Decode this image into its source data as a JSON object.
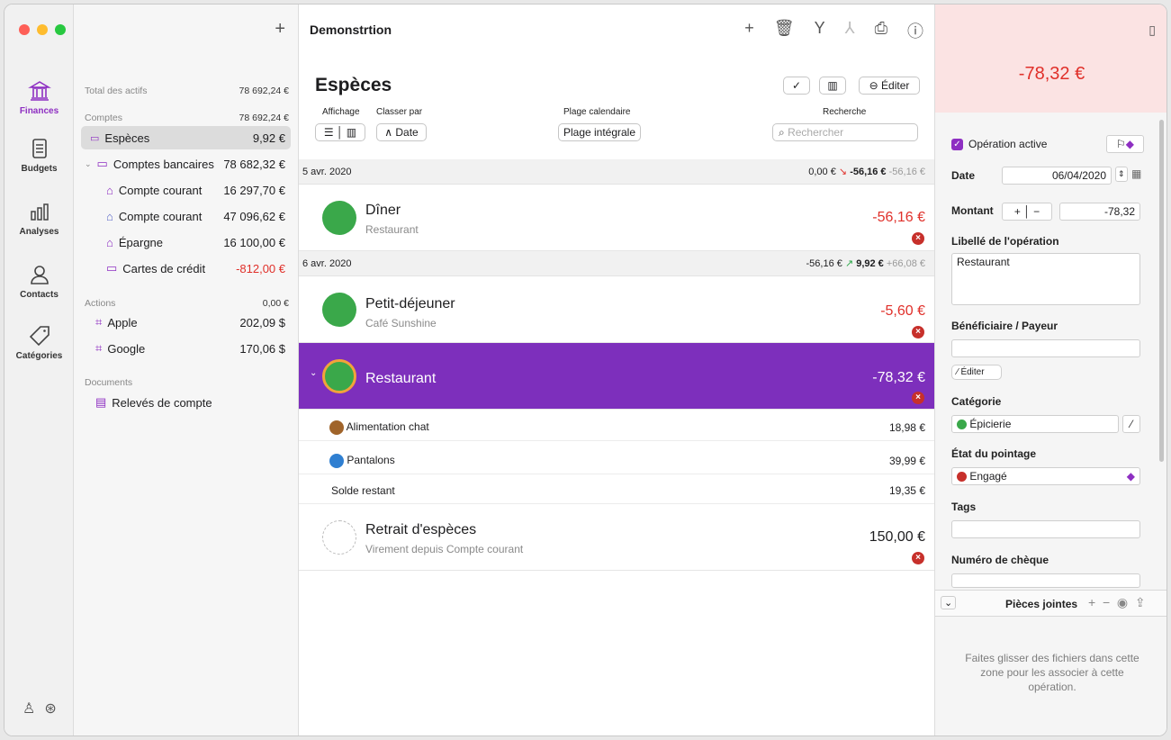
{
  "nav": [
    {
      "label": "Finances",
      "icon": "bank-icon",
      "active": true
    },
    {
      "label": "Budgets",
      "icon": "document-icon",
      "active": false
    },
    {
      "label": "Analyses",
      "icon": "bars-icon",
      "active": false
    },
    {
      "label": "Contacts",
      "icon": "person-icon",
      "active": false
    },
    {
      "label": "Catégories",
      "icon": "tag-icon",
      "active": false
    }
  ],
  "sidebar": {
    "total_label": "Total des actifs",
    "total_value": "78 692,24 €",
    "comptes_label": "Comptes",
    "comptes_value": "78 692,24 €",
    "accounts": [
      {
        "label": "Espèces",
        "value": "9,92 €"
      },
      {
        "label": "Comptes bancaires",
        "value": "78 682,32 €"
      },
      {
        "label": "Compte courant",
        "value": "16 297,70 €"
      },
      {
        "label": "Compte courant",
        "value": "47 096,62 €"
      },
      {
        "label": "Épargne",
        "value": "16 100,00 €"
      },
      {
        "label": "Cartes de crédit",
        "value": "-812,00 €"
      }
    ],
    "actions_label": "Actions",
    "actions_value": "0,00 €",
    "stocks": [
      {
        "label": "Apple",
        "value": "202,09 $"
      },
      {
        "label": "Google",
        "value": "170,06 $"
      }
    ],
    "documents_label": "Documents",
    "doc_item": "Relevés de compte"
  },
  "toolbar": {
    "title": "Demonstrtion"
  },
  "header": {
    "title": "Espèces",
    "edit": "Éditer",
    "affichage": "Affichage",
    "classer": "Classer par",
    "sort_value": "Date",
    "plage_label": "Plage calendaire",
    "plage_value": "Plage intégrale",
    "search_label": "Recherche",
    "search_placeholder": "Rechercher"
  },
  "groups": [
    {
      "date": "5 avr. 2020",
      "start": "0,00 €",
      "end": "-56,16 €",
      "delta": "-56,16 €"
    },
    {
      "date": "6 avr. 2020",
      "start": "-56,16 €",
      "end": "9,92 €",
      "delta": "+66,08 €"
    }
  ],
  "transactions": [
    {
      "name": "Dîner",
      "sub": "Restaurant",
      "amount": "-56,16 €"
    },
    {
      "name": "Petit-déjeuner",
      "sub": "Café Sunshine",
      "amount": "-5,60 €"
    },
    {
      "name": "Restaurant",
      "sub": "",
      "amount": "-78,32 €"
    },
    {
      "name": "Retrait d'espèces",
      "sub": "Virement depuis Compte courant",
      "amount": "150,00 €"
    }
  ],
  "splits": [
    {
      "label": "Alimentation chat",
      "value": "18,98 €"
    },
    {
      "label": "Pantalons",
      "value": "39,99 €"
    },
    {
      "label": "Solde restant",
      "value": "19,35 €"
    }
  ],
  "inspector": {
    "amount": "-78,32 €",
    "active": "Opération active",
    "date_label": "Date",
    "date_value": "06/04/2020",
    "montant_label": "Montant",
    "montant_value": "-78,32",
    "libelle_label": "Libellé de l'opération",
    "libelle_value": "Restaurant",
    "benef_label": "Bénéficiaire / Payeur",
    "edit": "Éditer",
    "cat_label": "Catégorie",
    "cat_value": "Épicierie",
    "etat_label": "État du pointage",
    "etat_value": "Engagé",
    "tags_label": "Tags",
    "cheque_label": "Numéro de chèque",
    "pj_label": "Pièces jointes",
    "drop_text": "Faites glisser des fichiers dans cette zone pour les associer à cette opération."
  },
  "colors": {
    "accent": "#8e2fc2",
    "negative": "#e0302a",
    "highlight": "#7d2fbc"
  }
}
